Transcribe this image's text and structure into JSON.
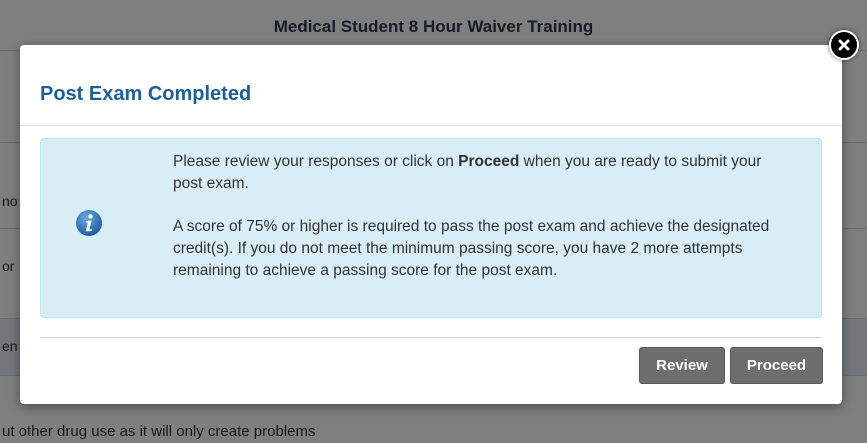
{
  "background": {
    "title": "Medical Student 8 Hour Waiver Training",
    "bottom_text": "ut other drug use as it will only create problems",
    "fragments": [
      "no",
      "or",
      "en"
    ]
  },
  "modal": {
    "title": "Post Exam Completed",
    "message": {
      "line1_prefix": "Please review your responses or click on ",
      "line1_bold": "Proceed",
      "line1_suffix": " when you are ready to submit your post exam.",
      "paragraph2": "A score of 75% or higher is required to pass the post exam and achieve the designated credit(s).  If you do not meet the minimum passing score, you have 2 more attempts remaining to achieve a passing score for the post exam."
    },
    "buttons": {
      "review": "Review",
      "proceed": "Proceed"
    },
    "icons": {
      "info": "info-icon",
      "close": "close-icon"
    },
    "colors": {
      "title": "#1b5f9b",
      "info_bg": "#d9edf7",
      "button_bg": "#6e6e6e"
    }
  }
}
